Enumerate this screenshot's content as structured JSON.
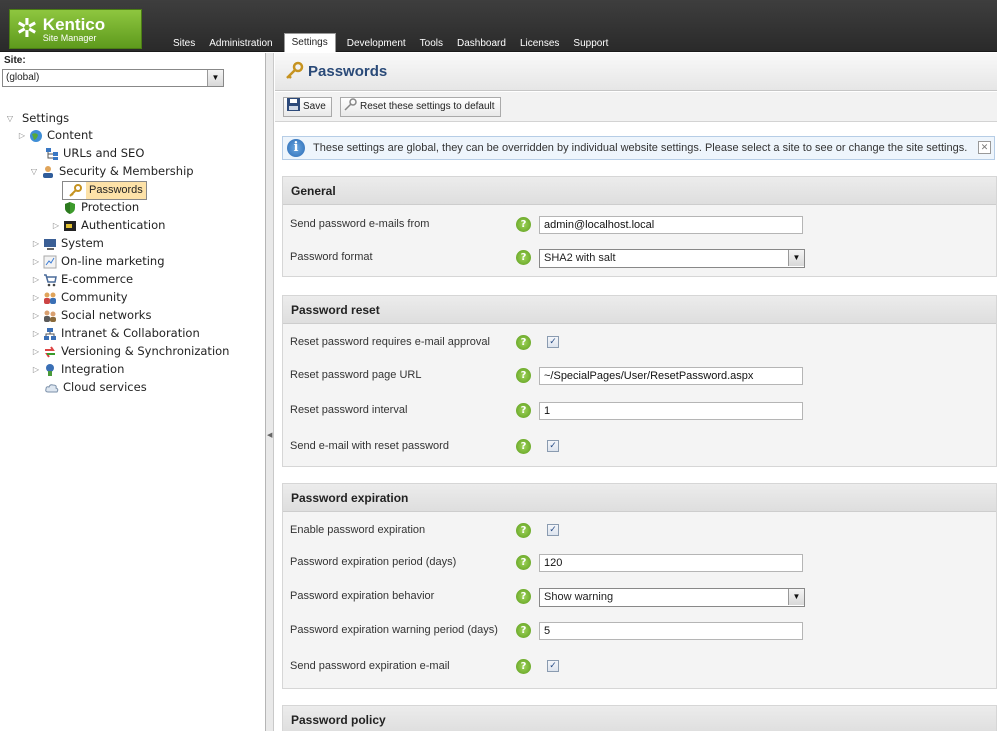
{
  "app": {
    "brand": "Kentico",
    "subtitle": "Site Manager"
  },
  "nav": {
    "tabs": [
      {
        "label": "Sites"
      },
      {
        "label": "Administration"
      },
      {
        "label": "Settings",
        "active": true
      },
      {
        "label": "Development"
      },
      {
        "label": "Tools"
      },
      {
        "label": "Dashboard"
      },
      {
        "label": "Licenses"
      },
      {
        "label": "Support"
      }
    ]
  },
  "site": {
    "label": "Site:",
    "selected": "(global)"
  },
  "tree": {
    "root": "Settings",
    "items": [
      {
        "label": "Content",
        "icon": "globe-icon"
      },
      {
        "label": "URLs and SEO",
        "icon": "sitemap-icon"
      },
      {
        "label": "Security & Membership",
        "icon": "user-icon"
      },
      {
        "label": "Passwords",
        "icon": "key-icon",
        "selected": true
      },
      {
        "label": "Protection",
        "icon": "shield-icon"
      },
      {
        "label": "Authentication",
        "icon": "card-icon"
      },
      {
        "label": "System",
        "icon": "computer-icon"
      },
      {
        "label": "On-line marketing",
        "icon": "chart-icon"
      },
      {
        "label": "E-commerce",
        "icon": "cart-icon"
      },
      {
        "label": "Community",
        "icon": "group-icon"
      },
      {
        "label": "Social networks",
        "icon": "people-icon"
      },
      {
        "label": "Intranet & Collaboration",
        "icon": "network-icon"
      },
      {
        "label": "Versioning & Synchronization",
        "icon": "sync-icon"
      },
      {
        "label": "Integration",
        "icon": "plug-icon"
      },
      {
        "label": "Cloud services",
        "icon": "cloud-icon"
      }
    ]
  },
  "page": {
    "title": "Passwords"
  },
  "toolbar": {
    "save": "Save",
    "reset": "Reset these settings to default"
  },
  "info": {
    "text": "These settings are global, they can be overridden by individual website settings. Please select a site to see or change the site settings."
  },
  "sections": {
    "general": {
      "title": "General",
      "send_from_label": "Send password e-mails from",
      "send_from_value": "admin@localhost.local",
      "format_label": "Password format",
      "format_value": "SHA2 with salt"
    },
    "reset": {
      "title": "Password reset",
      "approval_label": "Reset password requires e-mail approval",
      "approval_checked": true,
      "url_label": "Reset password page URL",
      "url_value": "~/SpecialPages/User/ResetPassword.aspx",
      "interval_label": "Reset password interval",
      "interval_value": "1",
      "send_label": "Send e-mail with reset password",
      "send_checked": true
    },
    "expiration": {
      "title": "Password expiration",
      "enable_label": "Enable password expiration",
      "enable_checked": true,
      "period_label": "Password expiration period (days)",
      "period_value": "120",
      "behavior_label": "Password expiration behavior",
      "behavior_value": "Show warning",
      "warning_label": "Password expiration warning period (days)",
      "warning_value": "5",
      "send_label": "Send password expiration e-mail",
      "send_checked": true
    },
    "policy": {
      "title": "Password policy"
    }
  },
  "colors": {
    "accent_green": "#6fb02a",
    "title_blue": "#2a4a78",
    "selection": "#fde2a8"
  }
}
